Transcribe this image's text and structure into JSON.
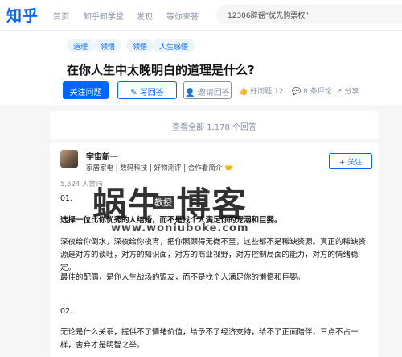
{
  "header": {
    "logo": "知乎",
    "nav": [
      "首页",
      "知乎知学堂",
      "发现",
      "等你来答"
    ],
    "search_text": "12306辟谣“优先购票权”"
  },
  "question": {
    "tags": [
      "道理",
      "领悟",
      "领悟",
      "人生感悟"
    ],
    "title": "在你人生中太晚明白的道理是什么?",
    "follow_label": "关注问题",
    "answer_label": "写回答",
    "invite_label": "邀请回答",
    "meta": [
      "好问题 12",
      "8 条评论",
      "分享"
    ]
  },
  "view_all": "查看全部 1,178 个回答",
  "answer": {
    "author": "宇宙新一",
    "bio": "家居家电 | 数码科技 | 好物测评 | 合作看简介",
    "follow_label": "+ 关注",
    "votes": "5,524 人赞同",
    "paragraphs": [
      "01.",
      "选择一位比你优秀的人结婚，而不是找个人满足你的宠溺和巨婴。",
      "深夜给你倒水，深夜给你夜宵，把你照顾得无微不至，这些都不是稀缺资源。真正的稀缺资源是对方的谈吐，对方的知识面，对方的商业视野，对方控制局面的能力，对方的情绪稳定。",
      "最佳的配偶，是你人生战场的盟友，而不是找个人满足你的懒惰和巨婴。",
      "02.",
      "无论是什么关系，提供不了情绪价值，给予不了经济支持，给不了正面陪伴，三点不占一样，舍弃才是明智之举。"
    ]
  },
  "watermark": {
    "main": "蜗牛  博客",
    "sub": "教授",
    "url": "www.woniuboke.com"
  },
  "colors": {
    "brand": "#0066ff",
    "muted": "#8590a6"
  }
}
